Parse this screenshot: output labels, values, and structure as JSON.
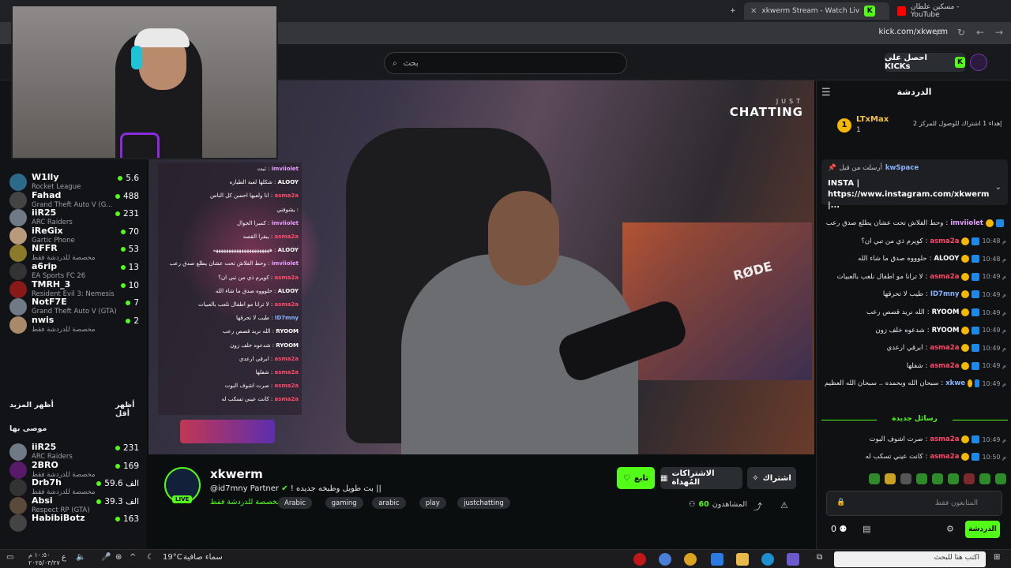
{
  "browser": {
    "tabs": [
      {
        "title": "مسكين علطان - YouTube",
        "active": false
      },
      {
        "title": "xkwerm Stream - Watch Liv",
        "active": true
      }
    ],
    "new_tab": "+",
    "url": "kick.com/xkwerm"
  },
  "header": {
    "search_placeholder": "بحث",
    "kicks_button": "احصل على KICKs"
  },
  "sidebar": {
    "channels": [
      {
        "name": "W1lly",
        "game": "Rocket League",
        "viewers": "5.6",
        "color": "#2c6a8a"
      },
      {
        "name": "Fahad",
        "game": "Grand Theft Auto V (G...",
        "viewers": "488",
        "color": "#444"
      },
      {
        "name": "iiR25",
        "game": "ARC Raiders",
        "viewers": "231",
        "color": "#6f7a86"
      },
      {
        "name": "iReGix",
        "game": "Gartic Phone",
        "viewers": "70",
        "color": "#b99a7a"
      },
      {
        "name": "NFFR",
        "game": "مخصصة للدردشة فقط",
        "viewers": "53",
        "color": "#8b7a2a"
      },
      {
        "name": "a6rip",
        "game": "EA Sports FC 26",
        "viewers": "13",
        "color": "#333"
      },
      {
        "name": "TMRH_3",
        "game": "Resident Evil 3: Nemesis",
        "viewers": "10",
        "color": "#8a1a1a"
      },
      {
        "name": "NotF7E",
        "game": "Grand Theft Auto V (GTA)",
        "viewers": "7",
        "color": "#6f7a86"
      },
      {
        "name": "nwis",
        "game": "مخصصة للدردشة فقط",
        "viewers": "2",
        "color": "#a88a6a"
      }
    ],
    "show_more": "أظهر المزيد",
    "show_less": "أظهر أقل",
    "recommended_title": "موصى بها",
    "recommended": [
      {
        "name": "iiR25",
        "game": "ARC Raiders",
        "viewers": "231",
        "color": "#6f7a86"
      },
      {
        "name": "2BRO",
        "game": "مخصصة للدردشة فقط",
        "viewers": "169",
        "color": "#5a1a6a"
      },
      {
        "name": "Drb7h",
        "game": "مخصصة للدردشة فقط",
        "viewers": "59.6 الف",
        "color": "#333"
      },
      {
        "name": "Absi",
        "game": "Respect RP (GTA)",
        "viewers": "39.3 الف",
        "color": "#5a4a3a"
      },
      {
        "name": "HabibiBotz",
        "game": "",
        "viewers": "163",
        "color": "#444"
      }
    ]
  },
  "video": {
    "overlay_just": "JUST",
    "overlay_chatting": "CHATTING",
    "mic_brand": "RØDE",
    "overlay_chat": [
      {
        "user": "imviiolet",
        "text": "ثبت",
        "color": "#e8a0ff"
      },
      {
        "user": "ALOOY",
        "text": "شكلها لعبة الطياره",
        "color": "#fff"
      },
      {
        "user": "asma2a",
        "text": "انا ولعبها احسن كل الناس",
        "color": "#ff4a6a"
      },
      {
        "user": "",
        "text": "يشوفني",
        "color": "#fff"
      },
      {
        "user": "imviiolet",
        "text": "كمبرا الجوال",
        "color": "#e8a0ff"
      },
      {
        "user": "asma2a",
        "text": "يبقرا القصه",
        "color": "#ff4a6a"
      },
      {
        "user": "ALOOY",
        "text": "ههههههههههههههههههههههه",
        "color": "#fff"
      },
      {
        "user": "imviiolet",
        "text": "وحط الفلاش تحت عشان يطلع صدق رعب",
        "color": "#e8a0ff"
      },
      {
        "user": "asma2a",
        "text": "كويرم ذي من تبي ان؟",
        "color": "#ff4a6a"
      },
      {
        "user": "ALOOY",
        "text": "حلوووه صدق ما شاء الله",
        "color": "#fff"
      },
      {
        "user": "asma2a",
        "text": "لا ترانا مو اطفال نلعب بالعبيات",
        "color": "#ff4a6a"
      },
      {
        "user": "ID7mny",
        "text": "طيب لا تحرقها",
        "color": "#8ab4ff"
      },
      {
        "user": "RYOOM",
        "text": "الله نريد قصص رعب",
        "color": "#fff"
      },
      {
        "user": "RYOOM",
        "text": "شدعوه خلف زون",
        "color": "#fff"
      },
      {
        "user": "asma2a",
        "text": "ابرقي ارعدي",
        "color": "#ff4a6a"
      },
      {
        "user": "asma2a",
        "text": "شفلها",
        "color": "#ff4a6a"
      },
      {
        "user": "asma2a",
        "text": "صرت اشوف البوت",
        "color": "#ff4a6a"
      },
      {
        "user": "asma2a",
        "text": "كانت عيني تسكب له",
        "color": "#ff4a6a"
      }
    ]
  },
  "stream": {
    "streamer": "xkwerm",
    "live_label": "LIVE",
    "title": "! بث طويل وطبخه جديده ||",
    "partner": "@id7mny Partner",
    "category": "مخصصة للدردشة فقط",
    "tags": [
      "Arabic",
      "gaming",
      "arabic",
      "play",
      "justchatting"
    ],
    "follow": "تابع",
    "gift_subs": "الاشتراكات المُهداة",
    "subscribe": "اشتراك",
    "viewers_label": "المشاهدون",
    "viewers_count": "60"
  },
  "chat": {
    "title": "الدردشة",
    "leader": {
      "rank": "1",
      "name": "LTxMax",
      "count": "1",
      "note": "إهداء 1 اشتراك للوصول للمركز 2"
    },
    "pinned": {
      "by_label": "أرسلت من قبل",
      "user": "kwSpace",
      "text": "INSTA | https://www.instagram.com/xkwerm |..."
    },
    "messages": [
      {
        "time": "",
        "user": "imviiolet",
        "text": "وحط الفلاش تحت عشان يطلع صدق رعب",
        "color": "#e8a0ff"
      },
      {
        "time": "10:48 م",
        "user": "asma2a",
        "text": "كويرم ذي من تبي ان؟",
        "color": "#ff4a6a"
      },
      {
        "time": "10:48 م",
        "user": "ALOOY",
        "text": "حلوووه صدق ما شاء الله",
        "color": "#fff"
      },
      {
        "time": "10:49 م",
        "user": "asma2a",
        "text": "لا ترانا مو اطفال نلعب بالعبيات",
        "color": "#ff4a6a"
      },
      {
        "time": "10:49 م",
        "user": "ID7mny",
        "text": "طيب لا تحرقها",
        "color": "#8ab4ff"
      },
      {
        "time": "10:49 م",
        "user": "RYOOM",
        "text": "الله نريد قصص رعب",
        "color": "#fff"
      },
      {
        "time": "10:49 م",
        "user": "RYOOM",
        "text": "شدعوه خلف زون",
        "color": "#fff"
      },
      {
        "time": "10:49 م",
        "user": "asma2a",
        "text": "ابرقي ارعدي",
        "color": "#ff4a6a"
      },
      {
        "time": "10:49 م",
        "user": "asma2a",
        "text": "شفلها",
        "color": "#ff4a6a"
      },
      {
        "time": "10:49 م",
        "user": "xkwe",
        "text": "سبحان الله وبحمده .. سبحان الله العظيم",
        "color": "#8ab4ff"
      }
    ],
    "new_messages": "رسائل جديدة",
    "new": [
      {
        "time": "10:49 م",
        "user": "asma2a",
        "text": "صرت اشوف البوت",
        "color": "#ff4a6a"
      },
      {
        "time": "10:50 م",
        "user": "asma2a",
        "text": "كانت عيني تسكب له",
        "color": "#ff4a6a"
      }
    ],
    "input_placeholder": "المتابعون فقط",
    "send": "الدردشة",
    "points": "0"
  },
  "taskbar": {
    "weather_temp": "19°C",
    "weather_desc": "سماء صافية",
    "clock_time": "١٠:٥٠ م",
    "clock_date": "٢٠٢٥/٠٣/٢٧",
    "search_text": "اكتب هنا للبحث",
    "lang": "ع"
  },
  "colors": {
    "brand": "#53fc18",
    "bg": "#0b0e0f"
  }
}
